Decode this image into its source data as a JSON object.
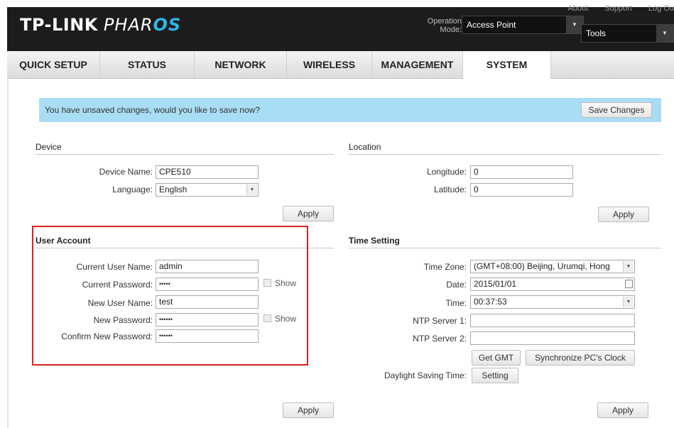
{
  "header": {
    "brand_main": "TP-LINK",
    "brand_product_prefix": "PHAR",
    "brand_product_suffix": "OS",
    "top_links": [
      "About",
      "Support",
      "Log Ou"
    ],
    "operation_mode_label_line1": "Operation",
    "operation_mode_label_line2": "Mode:",
    "operation_mode_value": "Access Point",
    "tools_value": "Tools"
  },
  "nav": {
    "tabs": [
      "QUICK SETUP",
      "STATUS",
      "NETWORK",
      "WIRELESS",
      "MANAGEMENT",
      "SYSTEM"
    ],
    "active": "SYSTEM"
  },
  "banner": {
    "message": "You have unsaved changes, would you like to save now?",
    "save_label": "Save Changes"
  },
  "device": {
    "title": "Device",
    "name_label": "Device Name:",
    "name_value": "CPE510",
    "language_label": "Language:",
    "language_value": "English",
    "apply_label": "Apply"
  },
  "location": {
    "title": "Location",
    "longitude_label": "Longitude:",
    "longitude_value": "0",
    "latitude_label": "Latitude:",
    "latitude_value": "0",
    "apply_label": "Apply"
  },
  "user_account": {
    "title": "User Account",
    "current_user_label": "Current User Name:",
    "current_user_value": "admin",
    "current_password_label": "Current Password:",
    "current_password_value": "•••••",
    "new_user_label": "New User Name:",
    "new_user_value": "test",
    "new_password_label": "New Password:",
    "new_password_value": "••••••",
    "confirm_password_label": "Confirm New Password:",
    "confirm_password_value": "••••••",
    "show_label": "Show",
    "apply_label": "Apply"
  },
  "time_setting": {
    "title": "Time Setting",
    "timezone_label": "Time Zone:",
    "timezone_value": "(GMT+08:00) Beijing, Urumqi, Hong",
    "date_label": "Date:",
    "date_value": "2015/01/01",
    "time_label": "Time:",
    "time_value": "00:37:53",
    "ntp1_label": "NTP Server 1:",
    "ntp1_value": "",
    "ntp2_label": "NTP Server 2:",
    "ntp2_value": "",
    "get_gmt_label": "Get GMT",
    "sync_label": "Synchronize PC's Clock",
    "dst_label": "Daylight Saving Time:",
    "dst_setting_label": "Setting",
    "apply_label": "Apply"
  },
  "colors": {
    "header_bg": "#1c1c1c",
    "brand_accent": "#2fb6e8",
    "banner_bg": "#a9ddf5",
    "highlight_border": "#e02020"
  }
}
